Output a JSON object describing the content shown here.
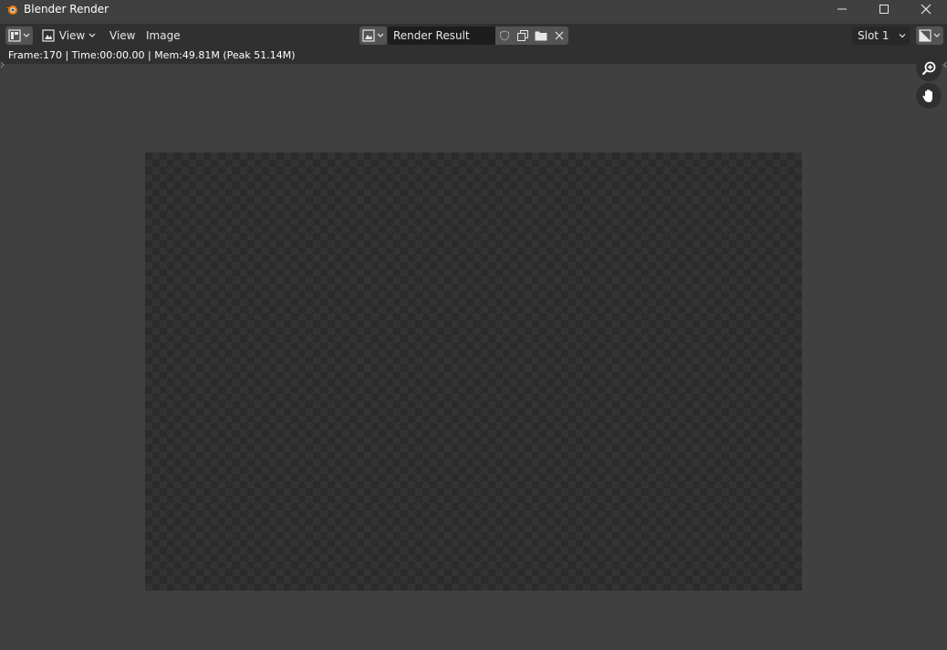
{
  "window": {
    "title": "Blender Render",
    "logo_icon": "blender-logo-icon",
    "controls": [
      "minimize-icon",
      "maximize-icon",
      "close-icon"
    ]
  },
  "header": {
    "editor_type_icon": "image-editor-icon",
    "view_mode_label": "View",
    "view_mode_icon": "image-view-icon",
    "menus": [
      "View",
      "Image"
    ],
    "image_name": "Render Result",
    "image_buttons": [
      "fake-user-icon",
      "new-image-icon",
      "open-folder-icon",
      "unlink-icon"
    ],
    "slot": "Slot 1",
    "display_channels_icon": "display-channels-icon"
  },
  "status": {
    "text": "Frame:170 | Time:00:00.00 | Mem:49.81M (Peak 51.14M)"
  },
  "gizmos": [
    "zoom-icon",
    "pan-hand-icon"
  ],
  "colors": {
    "background": "#404040",
    "header": "#303030",
    "button": "#545454",
    "field": "#1d1d1d",
    "logo_orange": "#e87d0d",
    "logo_blue": "#265787"
  }
}
